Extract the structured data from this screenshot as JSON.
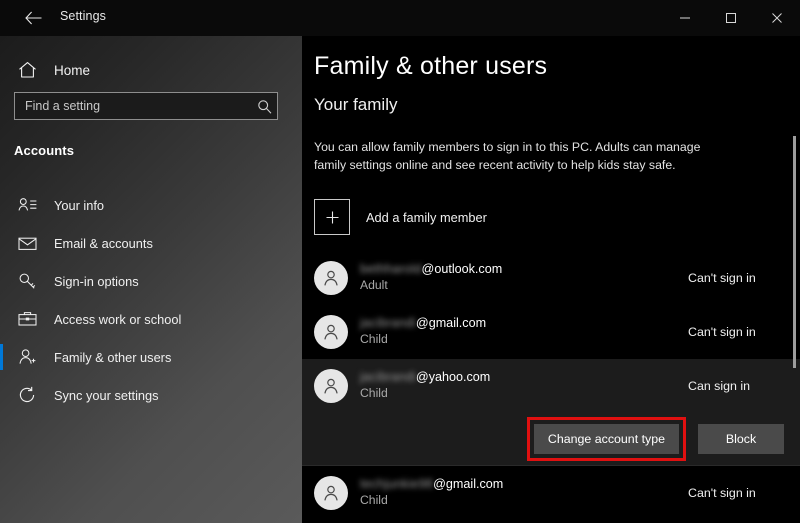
{
  "window": {
    "app_title": "Settings",
    "back_label": "Back",
    "controls": {
      "minimize": "Minimize",
      "maximize": "Maximize",
      "close": "Close"
    }
  },
  "sidebar": {
    "home_label": "Home",
    "search": {
      "placeholder": "Find a setting",
      "value": ""
    },
    "section_label": "Accounts",
    "items": [
      {
        "label": "Your info",
        "icon": "your-info-icon",
        "selected": false
      },
      {
        "label": "Email & accounts",
        "icon": "mail-icon",
        "selected": false
      },
      {
        "label": "Sign-in options",
        "icon": "key-icon",
        "selected": false
      },
      {
        "label": "Access work or school",
        "icon": "briefcase-icon",
        "selected": false
      },
      {
        "label": "Family & other users",
        "icon": "person-add-icon",
        "selected": true
      },
      {
        "label": "Sync your settings",
        "icon": "sync-icon",
        "selected": false
      }
    ]
  },
  "main": {
    "page_title": "Family & other users",
    "section_title": "Your family",
    "description": "You can allow family members to sign in to this PC. Adults can manage family settings online and see recent activity to help kids stay safe.",
    "add_member_label": "Add a family member",
    "users": [
      {
        "name_redacted": "bethharold",
        "domain": "@outlook.com",
        "role": "Adult",
        "status": "Can't sign in",
        "highlighted": false,
        "actions": []
      },
      {
        "name_redacted": "jacibrandi",
        "domain": "@gmail.com",
        "role": "Child",
        "status": "Can't sign in",
        "highlighted": false,
        "actions": []
      },
      {
        "name_redacted": "jacibrandi",
        "domain": "@yahoo.com",
        "role": "Child",
        "status": "Can sign in",
        "highlighted": true,
        "actions": [
          {
            "label": "Change account type",
            "annotated": true
          },
          {
            "label": "Block",
            "annotated": false
          }
        ]
      },
      {
        "name_redacted": "techjunkie98",
        "domain": "@gmail.com",
        "role": "Child",
        "status": "Can't sign in",
        "highlighted": false,
        "actions": []
      }
    ]
  },
  "colors": {
    "accent": "#0078d7",
    "annotation": "#e01010",
    "background": "#000000",
    "button": "#4a4a4a",
    "row_highlight": "#1c1c1c"
  }
}
